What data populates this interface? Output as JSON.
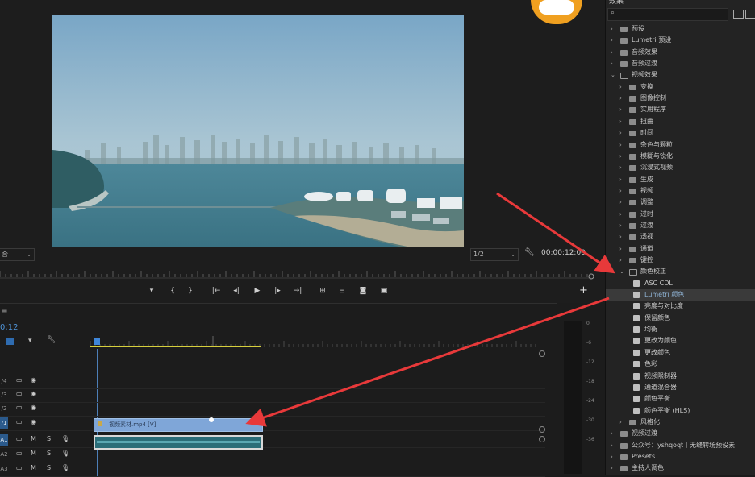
{
  "monitor": {
    "zoom_value": "合",
    "resolution_value": "1/2",
    "timecode": "00;00;12;00",
    "controls": [
      {
        "name": "add-marker-button",
        "glyph": "▾"
      },
      {
        "name": "mark-in-button",
        "glyph": "{"
      },
      {
        "name": "mark-out-button",
        "glyph": "}"
      },
      {
        "name": "go-to-in-button",
        "glyph": "|←"
      },
      {
        "name": "step-back-button",
        "glyph": "◂|"
      },
      {
        "name": "play-button",
        "glyph": "▶"
      },
      {
        "name": "step-forward-button",
        "glyph": "|▸"
      },
      {
        "name": "go-to-out-button",
        "glyph": "→|"
      },
      {
        "name": "lift-button",
        "glyph": "⊞"
      },
      {
        "name": "extract-button",
        "glyph": "⊟"
      },
      {
        "name": "export-frame-button",
        "glyph": "◙"
      },
      {
        "name": "comparison-view-button",
        "glyph": "▣"
      }
    ],
    "add_button": "+"
  },
  "timeline": {
    "menu": "≡",
    "timecode": "0;12",
    "tracks": [
      {
        "id": "V4",
        "label": "/4",
        "kind": "video",
        "active": false
      },
      {
        "id": "V3",
        "label": "/3",
        "kind": "video",
        "active": false
      },
      {
        "id": "V2",
        "label": "/2",
        "kind": "video",
        "active": false
      },
      {
        "id": "V1",
        "label": "/1",
        "kind": "video",
        "active": true
      },
      {
        "id": "A1",
        "label": "A1",
        "kind": "audio",
        "active": true
      },
      {
        "id": "A2",
        "label": "A2",
        "kind": "audio",
        "active": false
      },
      {
        "id": "A3",
        "label": "A3",
        "kind": "audio",
        "active": false
      }
    ],
    "audio_m": "M",
    "audio_s": "S",
    "clip_label": "视频素材.mp4 [V]"
  },
  "meter": {
    "db_labels": [
      "0",
      "-6",
      "-12",
      "-18",
      "-24",
      "-30",
      "-36"
    ]
  },
  "effects": {
    "header": "效果",
    "search_placeholder": "",
    "items": [
      {
        "label": "预设",
        "level": 0,
        "type": "folder",
        "expanded": false
      },
      {
        "label": "Lumetri 预设",
        "level": 0,
        "type": "folder",
        "expanded": false
      },
      {
        "label": "音频效果",
        "level": 0,
        "type": "folder",
        "expanded": false
      },
      {
        "label": "音频过渡",
        "level": 0,
        "type": "folder",
        "expanded": false
      },
      {
        "label": "视频效果",
        "level": 0,
        "type": "folder",
        "expanded": true
      },
      {
        "label": "变换",
        "level": 1,
        "type": "folder",
        "expanded": false
      },
      {
        "label": "图像控制",
        "level": 1,
        "type": "folder",
        "expanded": false
      },
      {
        "label": "实用程序",
        "level": 1,
        "type": "folder",
        "expanded": false
      },
      {
        "label": "扭曲",
        "level": 1,
        "type": "folder",
        "expanded": false
      },
      {
        "label": "时间",
        "level": 1,
        "type": "folder",
        "expanded": false
      },
      {
        "label": "杂色与颗粒",
        "level": 1,
        "type": "folder",
        "expanded": false
      },
      {
        "label": "模糊与锐化",
        "level": 1,
        "type": "folder",
        "expanded": false
      },
      {
        "label": "沉浸式视频",
        "level": 1,
        "type": "folder",
        "expanded": false
      },
      {
        "label": "生成",
        "level": 1,
        "type": "folder",
        "expanded": false
      },
      {
        "label": "视频",
        "level": 1,
        "type": "folder",
        "expanded": false
      },
      {
        "label": "调整",
        "level": 1,
        "type": "folder",
        "expanded": false
      },
      {
        "label": "过时",
        "level": 1,
        "type": "folder",
        "expanded": false
      },
      {
        "label": "过渡",
        "level": 1,
        "type": "folder",
        "expanded": false
      },
      {
        "label": "透视",
        "level": 1,
        "type": "folder",
        "expanded": false
      },
      {
        "label": "通道",
        "level": 1,
        "type": "folder",
        "expanded": false
      },
      {
        "label": "键控",
        "level": 1,
        "type": "folder",
        "expanded": false
      },
      {
        "label": "颜色校正",
        "level": 1,
        "type": "folder",
        "expanded": true
      },
      {
        "label": "ASC CDL",
        "level": 2,
        "type": "effect"
      },
      {
        "label": "Lumetri 颜色",
        "level": 2,
        "type": "effect",
        "selected": true
      },
      {
        "label": "亮度与对比度",
        "level": 2,
        "type": "effect"
      },
      {
        "label": "保留颜色",
        "level": 2,
        "type": "effect"
      },
      {
        "label": "均衡",
        "level": 2,
        "type": "effect"
      },
      {
        "label": "更改为颜色",
        "level": 2,
        "type": "effect"
      },
      {
        "label": "更改颜色",
        "level": 2,
        "type": "effect"
      },
      {
        "label": "色彩",
        "level": 2,
        "type": "effect"
      },
      {
        "label": "视频限制器",
        "level": 2,
        "type": "effect"
      },
      {
        "label": "通道混合器",
        "level": 2,
        "type": "effect"
      },
      {
        "label": "颜色平衡",
        "level": 2,
        "type": "effect"
      },
      {
        "label": "颜色平衡 (HLS)",
        "level": 2,
        "type": "effect"
      },
      {
        "label": "风格化",
        "level": 1,
        "type": "folder",
        "expanded": false
      },
      {
        "label": "视频过渡",
        "level": 0,
        "type": "folder",
        "expanded": false
      },
      {
        "label": "公众号：yshqoqt丨无缝转场预设素",
        "level": 0,
        "type": "folder",
        "expanded": false
      },
      {
        "label": "Presets",
        "level": 0,
        "type": "folder",
        "expanded": false
      },
      {
        "label": "主持人调色",
        "level": 0,
        "type": "folder",
        "expanded": false
      }
    ]
  },
  "colors": {
    "accent_blue": "#2b5a8c",
    "clip_blue": "#7fa6d8",
    "arrow_red": "#e8393a"
  }
}
